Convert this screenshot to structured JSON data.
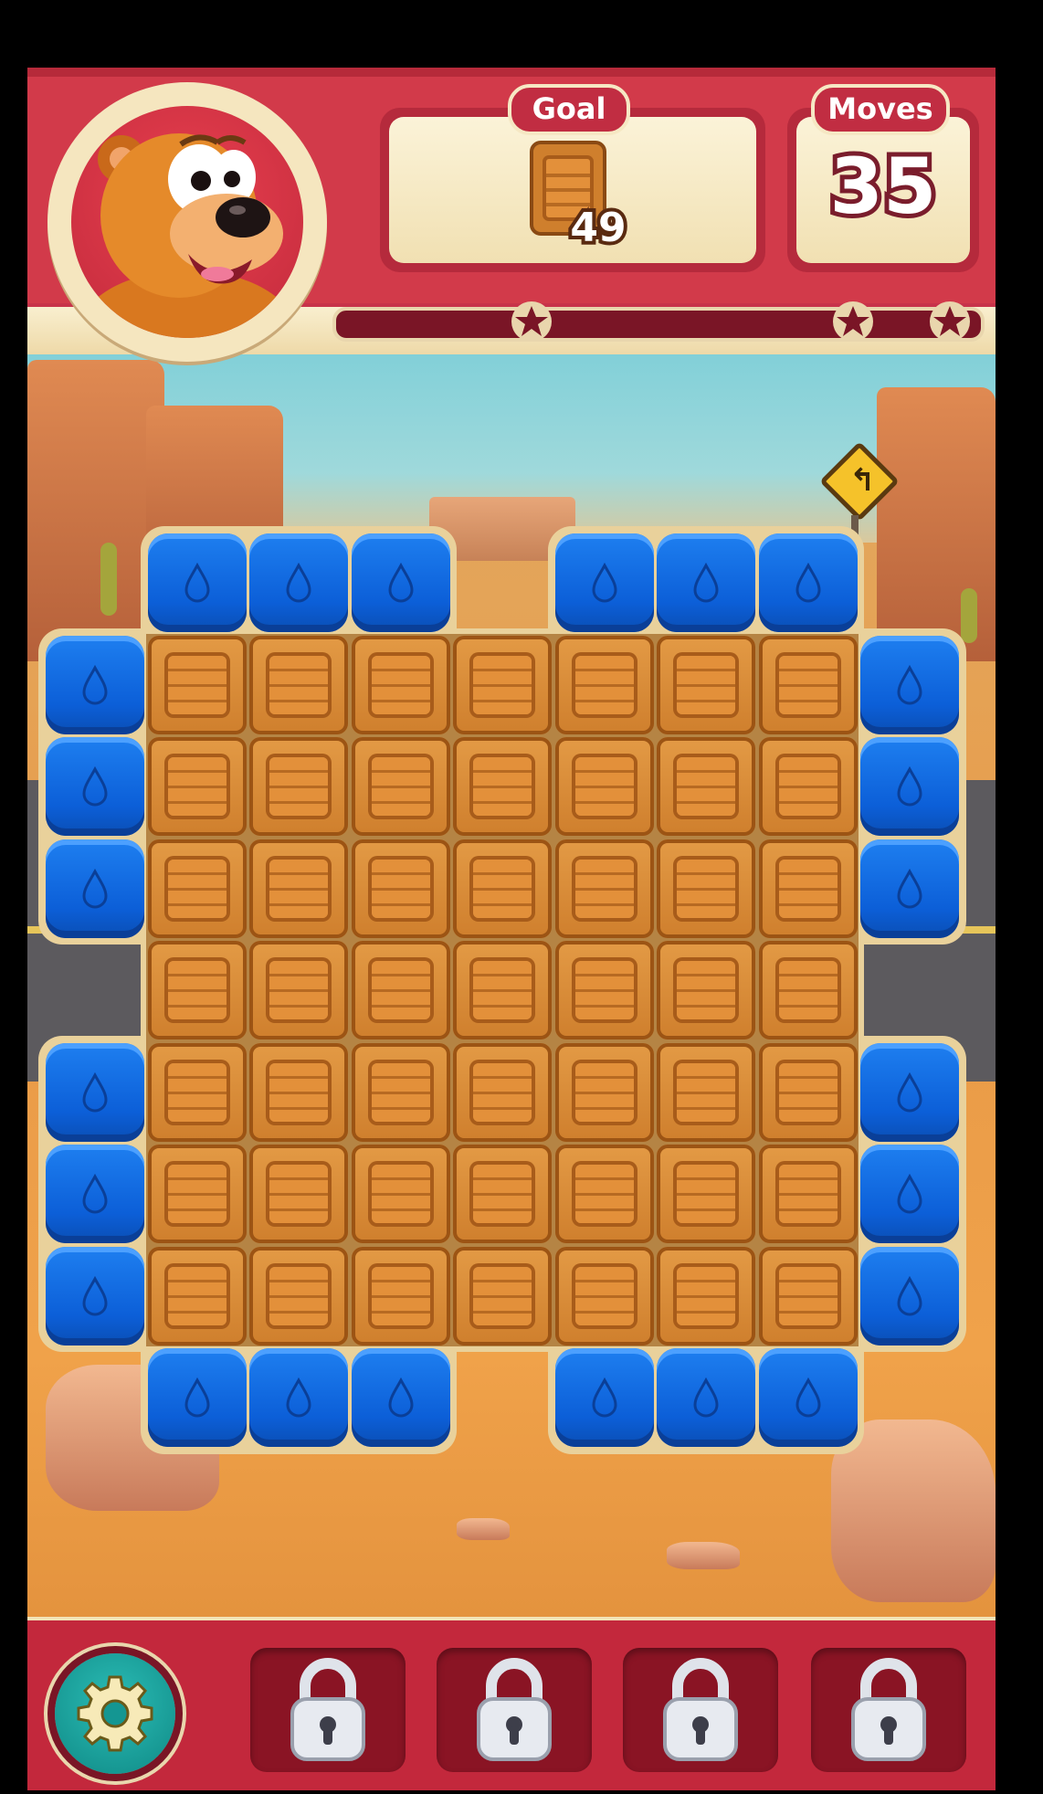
{
  "header": {
    "goal_label": "Goal",
    "goal_count": "49",
    "goal_item_icon": "wooden-crate-icon",
    "moves_label": "Moves",
    "moves_value": "35",
    "score_progress": 0,
    "stars_total": 3,
    "character_icon": "bear-avatar-icon"
  },
  "board": {
    "columns": 9,
    "rows": 9,
    "tile_types": {
      "B": "blue-water-cube",
      "C": "wooden-crate",
      ".": "empty"
    },
    "grid": [
      ".BBB.BBB.",
      "BCCCCCCCB",
      "BCCCCCCCB",
      "BCCCCCCCB",
      ".CCCCCCC.",
      "BCCCCCCCB",
      "BCCCCCCCB",
      "BCCCCCCCB",
      ".BBB.BBB."
    ]
  },
  "footer": {
    "settings_icon": "gear-icon",
    "booster_slots": [
      {
        "state": "locked",
        "icon": "padlock-icon"
      },
      {
        "state": "locked",
        "icon": "padlock-icon"
      },
      {
        "state": "locked",
        "icon": "padlock-icon"
      },
      {
        "state": "locked",
        "icon": "padlock-icon"
      }
    ]
  },
  "colors": {
    "header_red": "#d23a4a",
    "panel_cream": "#f8eccb",
    "blue_cube": "#0c5fd8",
    "crate": "#cf7f2d",
    "settings_teal": "#18a19c"
  }
}
